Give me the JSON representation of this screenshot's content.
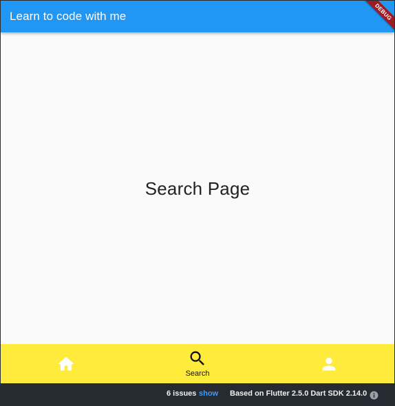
{
  "app_bar": {
    "title": "Learn to code with me"
  },
  "debug_banner": {
    "label": "DEBUG"
  },
  "main": {
    "heading": "Search Page"
  },
  "bottom_nav": {
    "items": [
      {
        "icon": "home-icon",
        "label": "",
        "selected": false
      },
      {
        "icon": "search-icon",
        "label": "Search",
        "selected": true
      },
      {
        "icon": "person-icon",
        "label": "",
        "selected": false
      }
    ],
    "background": "#ffeb3b"
  },
  "status_bar": {
    "issues": "6 issues",
    "show_label": "show",
    "sdk_info": "Based on Flutter 2.5.0 Dart SDK 2.14.0"
  },
  "colors": {
    "app_bar": "#2196f3",
    "page_background": "#fafafa",
    "debug_banner": "#9e1b24",
    "link": "#3b9df8"
  }
}
